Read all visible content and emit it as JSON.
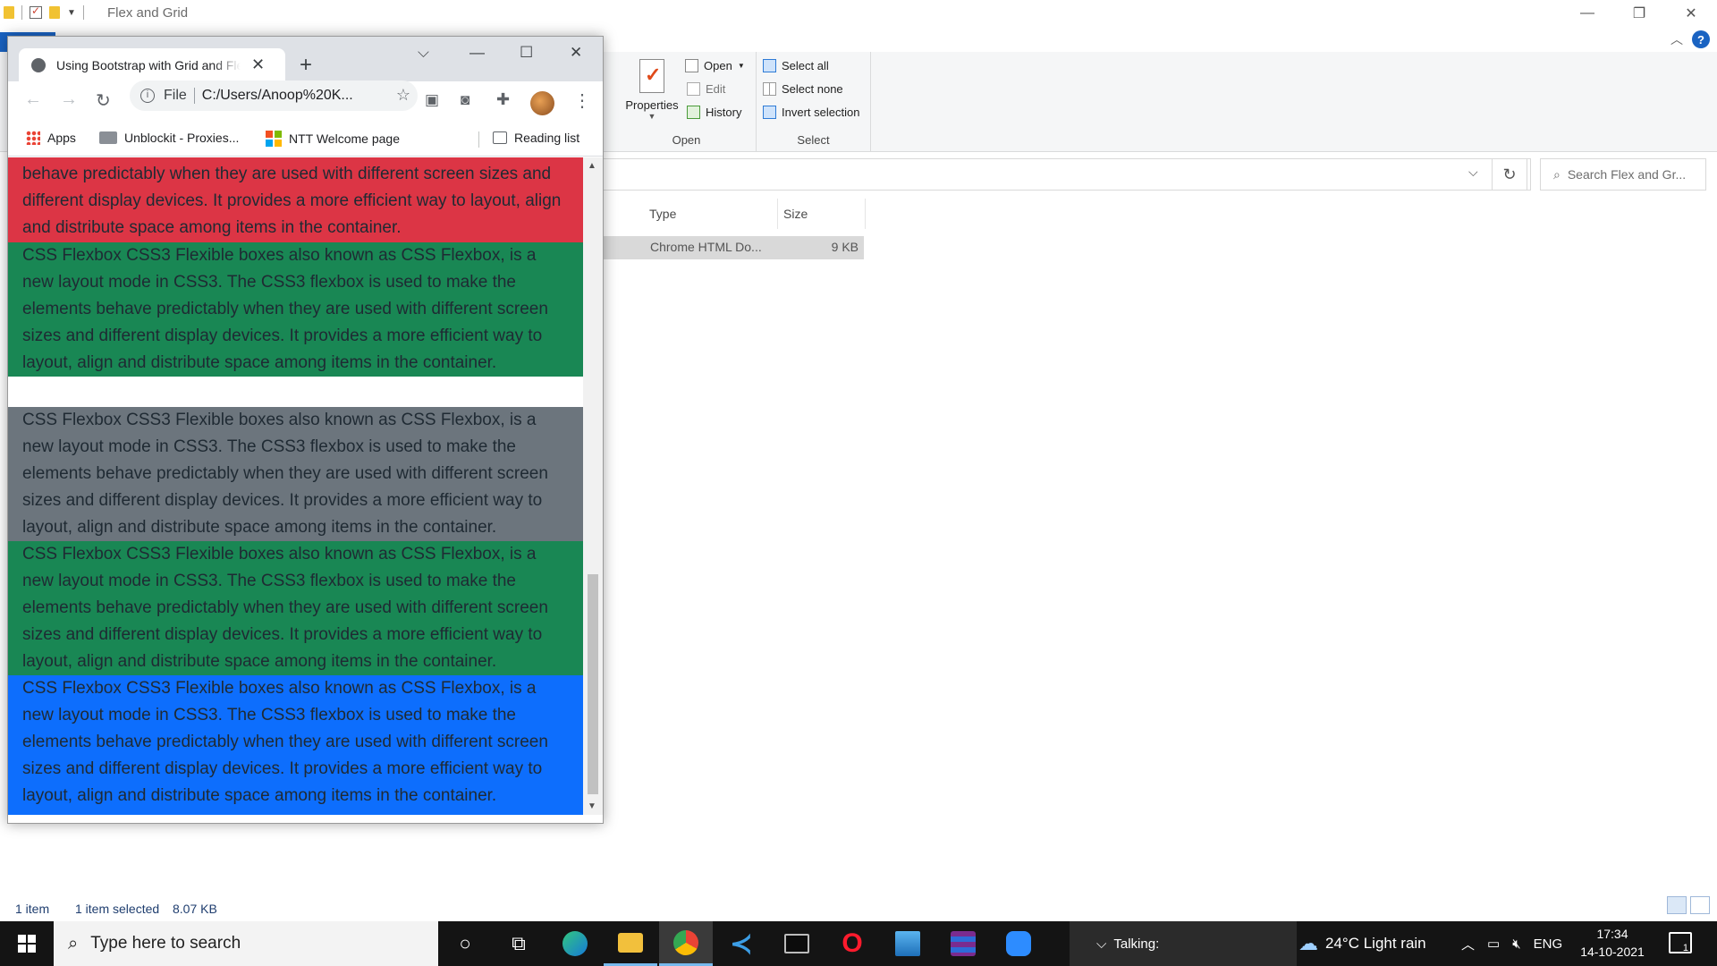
{
  "explorer": {
    "title": "Flex and Grid",
    "ribbon": {
      "properties_label": "Properties",
      "open_label": "Open",
      "edit_label": "Edit",
      "history_label": "History",
      "open_group_label": "Open",
      "select_all_label": "Select all",
      "select_none_label": "Select none",
      "invert_selection_label": "Invert selection",
      "select_group_label": "Select"
    },
    "search_placeholder": "Search Flex and Gr...",
    "columns": {
      "type": "Type",
      "size": "Size"
    },
    "file": {
      "type": "Chrome HTML Do...",
      "size": "9 KB"
    },
    "status": {
      "items": "1 item",
      "selected": "1 item selected",
      "selected_size": "8.07 KB"
    }
  },
  "chrome": {
    "tab_title": "Using Bootstrap with Grid and Flex",
    "omnibox": {
      "scheme_label": "File",
      "url": "C:/Users/Anoop%20K..."
    },
    "bookmarks": {
      "apps": "Apps",
      "unblockit": "Unblockit - Proxies...",
      "ntt": "NTT Welcome page",
      "reading_list": "Reading list"
    },
    "content": {
      "red_text": "behave predictably when they are used with different screen sizes and different display devices. It provides a more efficient way to layout, align and distribute space among items in the container.",
      "paragraph": "CSS Flexbox CSS3 Flexible boxes also known as CSS Flexbox, is a new layout mode in CSS3. The CSS3 flexbox is used to make the elements behave predictably when they are used with different screen sizes and different display devices. It provides a more efficient way to layout, align and distribute space among items in the container."
    },
    "colors": {
      "red": "#dc3545",
      "green": "#198754",
      "gray": "#6c757d",
      "blue": "#0d6efd"
    }
  },
  "taskbar": {
    "search_placeholder": "Type here to search",
    "talking": "Talking:",
    "weather": "24°C  Light rain",
    "language": "ENG",
    "time": "17:34",
    "date": "14-10-2021",
    "notifications": "1"
  }
}
